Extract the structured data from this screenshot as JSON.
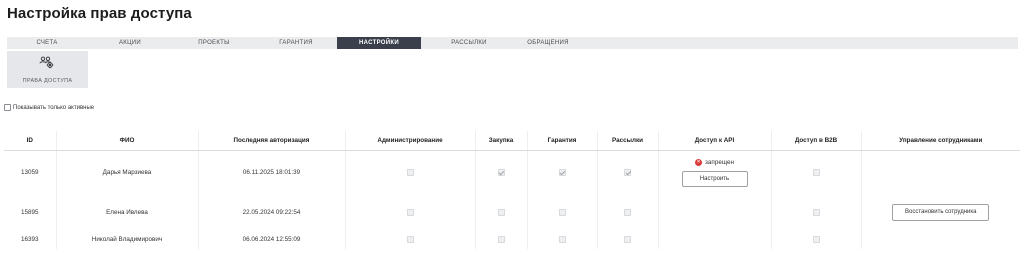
{
  "page": {
    "title": "Настройка прав доступа"
  },
  "tabs": [
    {
      "label": "СЧЕТА",
      "active": false
    },
    {
      "label": "АКЦИИ",
      "active": false
    },
    {
      "label": "ПРОЕКТЫ",
      "active": false
    },
    {
      "label": "ГАРАНТИЯ",
      "active": false
    },
    {
      "label": "НАСТРОЙКИ",
      "active": true
    },
    {
      "label": "РАССЫЛКИ",
      "active": false
    },
    {
      "label": "ОБРАЩЕНИЯ",
      "active": false
    }
  ],
  "subtab": {
    "label": "ПРАВА ДОСТУПА",
    "icon": "users-gear-icon"
  },
  "filter": {
    "label": "Показывать только активные",
    "checked": false
  },
  "table": {
    "headers": [
      "ID",
      "ФИО",
      "Последняя авторизация",
      "Администрирование",
      "Закупка",
      "Гарантия",
      "Рассылки",
      "Доступ к API",
      "Доступ в B2B",
      "Управление сотрудниками"
    ],
    "rows": [
      {
        "id": "13059",
        "name": "Дарья Марзиева",
        "last_login": "06.11.2025 18:01:39",
        "admin": false,
        "purchase": true,
        "warranty": true,
        "mailing": true,
        "api_status": "запрещен",
        "api_button": "Настроить",
        "b2b": false,
        "manage_button": ""
      },
      {
        "id": "15895",
        "name": "Елена Ивлева",
        "last_login": "22.05.2024 09:22:54",
        "admin": false,
        "purchase": false,
        "warranty": false,
        "mailing": false,
        "api_status": "",
        "api_button": "",
        "b2b": false,
        "manage_button": "Восстановить сотрудника"
      },
      {
        "id": "16393",
        "name": "Николай Владимирович",
        "last_login": "06.06.2024 12:55:09",
        "admin": false,
        "purchase": false,
        "warranty": false,
        "mailing": false,
        "api_status": "",
        "api_button": "",
        "b2b": false,
        "manage_button": ""
      }
    ]
  },
  "colors": {
    "active_tab": "#3a3f4b",
    "tabbar": "#eaecee",
    "error": "#d93a3a"
  }
}
